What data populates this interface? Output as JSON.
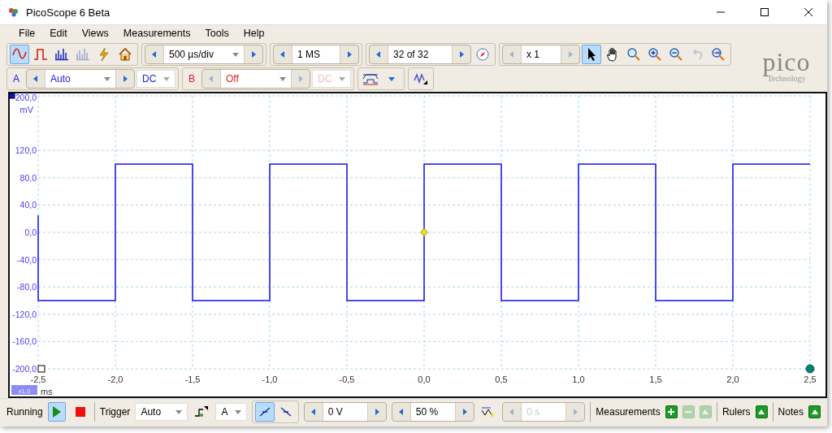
{
  "window": {
    "title": "PicoScope 6 Beta"
  },
  "menu": [
    {
      "label": "File"
    },
    {
      "label": "Edit"
    },
    {
      "label": "Views"
    },
    {
      "label": "Measurements"
    },
    {
      "label": "Tools"
    },
    {
      "label": "Help"
    }
  ],
  "view_buttons": [
    {
      "kind": "scope",
      "selected": true,
      "disabled": false
    },
    {
      "kind": "persistence",
      "selected": false,
      "disabled": false
    },
    {
      "kind": "spectrum",
      "selected": false,
      "disabled": false
    },
    {
      "kind": "spectrum",
      "selected": false,
      "disabled": true
    },
    {
      "kind": "lightning",
      "selected": false,
      "disabled": false
    },
    {
      "kind": "home",
      "selected": false,
      "disabled": false
    }
  ],
  "timebase": {
    "value": "500 µs/div"
  },
  "samples": {
    "value": "1 MS"
  },
  "buffer": {
    "value": "32 of 32"
  },
  "zoom": {
    "value": "x 1"
  },
  "zoom_tools": [
    {
      "kind": "pointer",
      "selected": true,
      "disabled": false
    },
    {
      "kind": "hand",
      "selected": false,
      "disabled": false
    },
    {
      "kind": "zoomfit",
      "selected": false,
      "disabled": false
    },
    {
      "kind": "zoomin",
      "selected": false,
      "disabled": false
    },
    {
      "kind": "zoomout",
      "selected": false,
      "disabled": false
    },
    {
      "kind": "undo",
      "selected": false,
      "disabled": true
    },
    {
      "kind": "zoom100",
      "selected": false,
      "disabled": false
    }
  ],
  "logo": {
    "name": "pico",
    "subtitle": "Technology"
  },
  "channels": [
    {
      "label": "A",
      "range": "Auto",
      "coupling": "DC",
      "enabled": true,
      "color": "#2020e0"
    },
    {
      "label": "B",
      "range": "Off",
      "coupling": "DC",
      "enabled": false,
      "color": "#e02020"
    }
  ],
  "scope": {
    "unit_y": "mV",
    "unit_x": "ms",
    "scale": "x1,0",
    "chart_data": {
      "type": "line",
      "grid": true,
      "x": [
        -2.5,
        -2.5,
        -2.0,
        -2.0,
        -1.5,
        -1.5,
        -1.0,
        -1.0,
        -0.5,
        -0.5,
        0,
        0,
        0.5,
        0.5,
        1.0,
        1.0,
        1.5,
        1.5,
        2.0,
        2.0,
        2.5
      ],
      "series": [
        {
          "color": "#1010f0",
          "values": [
            25,
            -100,
            -100,
            100,
            100,
            -100,
            -100,
            100,
            100,
            -100,
            -100,
            100,
            100,
            -100,
            -100,
            100,
            100,
            -100,
            -100,
            100,
            100
          ]
        }
      ],
      "xlim": [
        -2.5,
        2.5
      ],
      "ylim": [
        -200,
        200
      ],
      "xticks": [
        {
          "value": -2.5,
          "label": "-2,5"
        },
        {
          "value": -2.0,
          "label": "-2,0"
        },
        {
          "value": -1.5,
          "label": "-1,5"
        },
        {
          "value": -1.0,
          "label": "-1,0"
        },
        {
          "value": -0.5,
          "label": "-0,5"
        },
        {
          "value": 0,
          "label": "0,0"
        },
        {
          "value": 0.5,
          "label": "0,5"
        },
        {
          "value": 1.0,
          "label": "1,0"
        },
        {
          "value": 1.5,
          "label": "1,5"
        },
        {
          "value": 2.0,
          "label": "2,0"
        },
        {
          "value": 2.5,
          "label": "2,5"
        }
      ],
      "yticks": [
        {
          "value": 200,
          "label": "200,0"
        },
        {
          "value": 120,
          "label": "120,0"
        },
        {
          "value": 80,
          "label": "80,0"
        },
        {
          "value": 40,
          "label": "40,0"
        },
        {
          "value": 0,
          "label": "0,0"
        },
        {
          "value": -40,
          "label": "-40,0"
        },
        {
          "value": -80,
          "label": "-80,0"
        },
        {
          "value": -120,
          "label": "-120,0"
        },
        {
          "value": -160,
          "label": "-160,0"
        },
        {
          "value": -200,
          "label": "-200,0"
        }
      ]
    }
  },
  "status": {
    "state": "Running",
    "running": true
  },
  "trigger": {
    "label": "Trigger",
    "mode": "Auto",
    "source": "A",
    "rising": true,
    "threshold": "0 V",
    "pretrigger": "50 %",
    "delay": "0 s",
    "delay_enabled": false
  },
  "panels": [
    {
      "label": "Measurements",
      "buttons": [
        {
          "kind": "add",
          "disabled": false
        },
        {
          "kind": "remove",
          "disabled": true
        },
        {
          "kind": "edit",
          "disabled": true
        }
      ]
    },
    {
      "label": "Rulers",
      "buttons": [
        {
          "kind": "edit",
          "disabled": false
        }
      ]
    },
    {
      "label": "Notes",
      "buttons": [
        {
          "kind": "edit",
          "disabled": false
        }
      ]
    }
  ]
}
